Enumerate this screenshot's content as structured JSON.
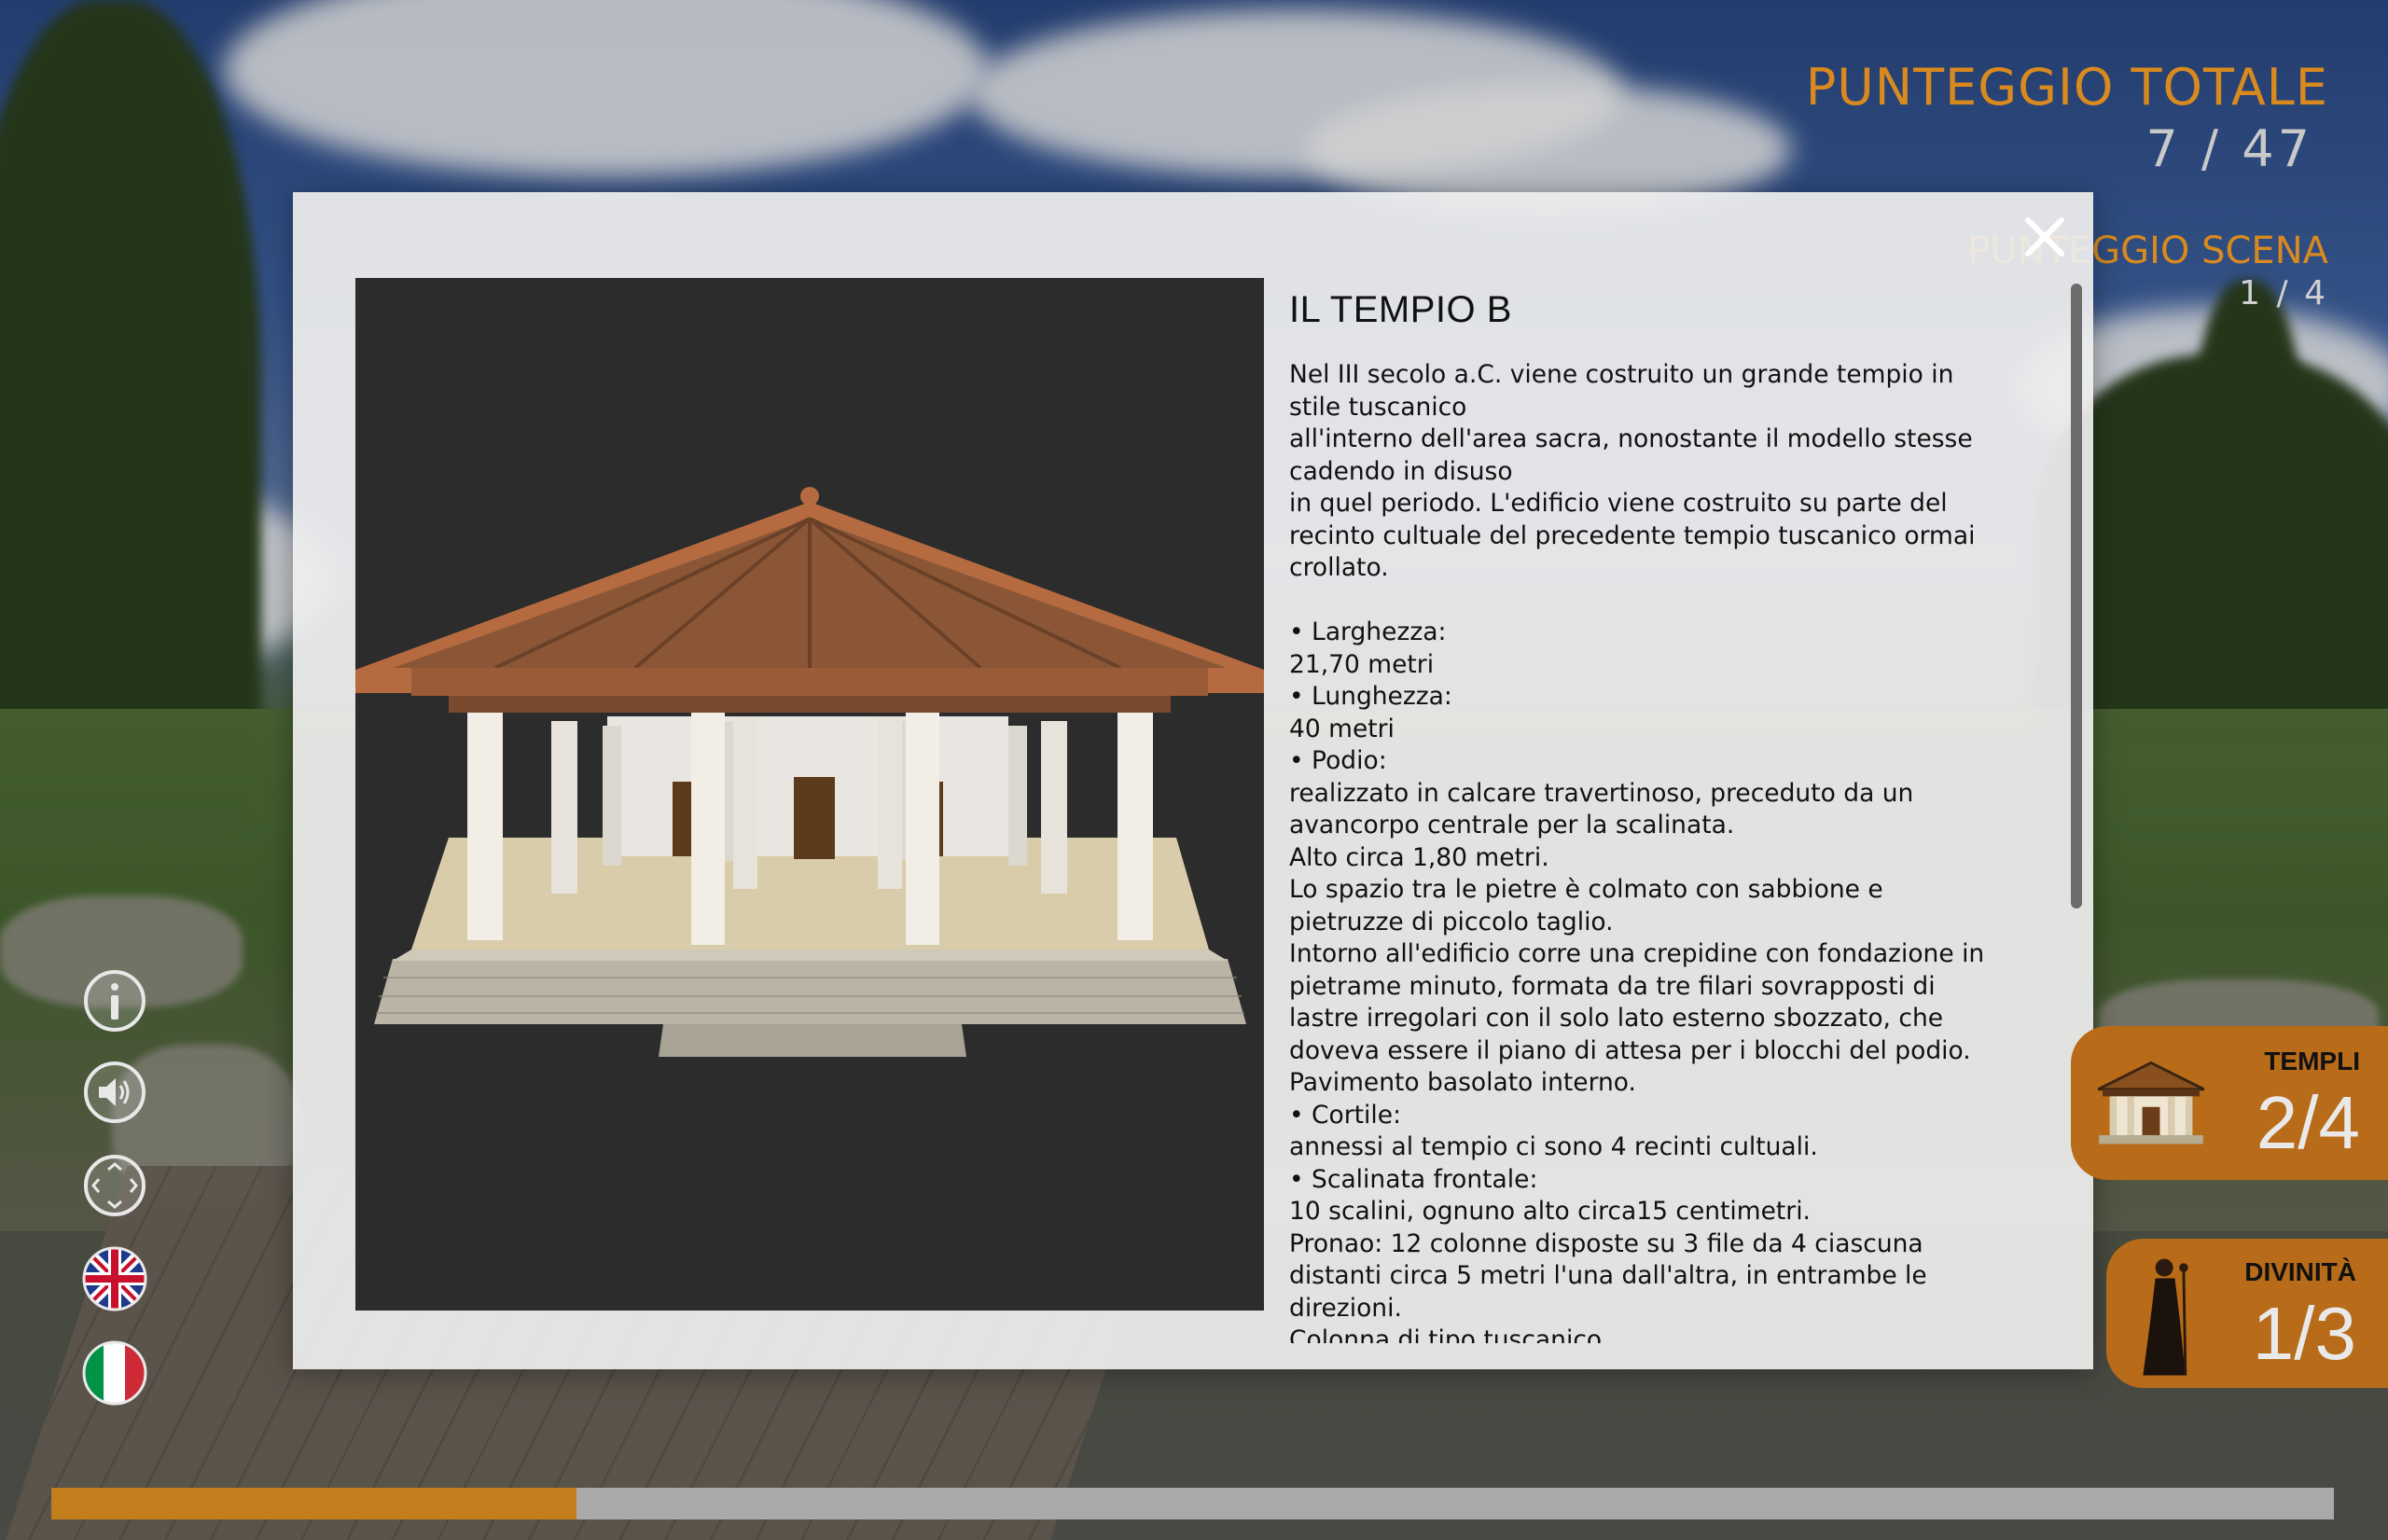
{
  "hud": {
    "total_label": "PUNTEGGIO TOTALE",
    "total_value": "7 / 47",
    "scene_label": "PUNTEGGIO SCENA",
    "scene_value": "1 / 4"
  },
  "modal": {
    "title": "IL TEMPIO B",
    "body": "Nel III secolo a.C. viene costruito un grande tempio in stile tuscanico\nall'interno dell'area sacra, nonostante il modello stesse cadendo in disuso\nin quel periodo. L'edificio viene costruito su parte del recinto cultuale del precedente tempio tuscanico ormai crollato.\n\n• Larghezza:\n 21,70 metri\n• Lunghezza:\n40 metri\n• Podio:\n realizzato in calcare travertinoso, preceduto da un avancorpo centrale per la scalinata.\nAlto circa 1,80 metri.\nLo spazio tra le pietre è colmato con sabbione e pietruzze di piccolo taglio.\nIntorno all'edificio corre una crepidine con fondazione in pietrame minuto, formata da tre filari sovrapposti di lastre irregolari con il solo lato esterno sbozzato, che doveva essere il piano di attesa per i blocchi del podio.\nPavimento basolato interno.\n• Cortile:\n annessi al tempio ci sono 4 recinti cultuali.\n• Scalinata frontale:\n 10 scalini, ognuno alto circa15 centimetri.\nPronao: 12 colonne disposte su 3 file da 4 ciascuna distanti circa 5 metri l'una dall'altra, in entrambe le direzioni.\nColonna di tipo tuscanico.",
    "close_icon": "close-icon"
  },
  "controls": [
    {
      "name": "info-icon"
    },
    {
      "name": "audio-icon"
    },
    {
      "name": "move-icon"
    },
    {
      "name": "flag-uk-icon"
    },
    {
      "name": "flag-italy-icon"
    }
  ],
  "badges": {
    "templi_label": "TEMPLI",
    "templi_value": "2/4",
    "divinita_label": "DIVINITÀ",
    "divinita_value": "1/3"
  },
  "progress": {
    "fraction": 0.23
  },
  "colors": {
    "accent": "#d98a1f",
    "badge": "#b86b18",
    "progress": "#c27e1c"
  }
}
